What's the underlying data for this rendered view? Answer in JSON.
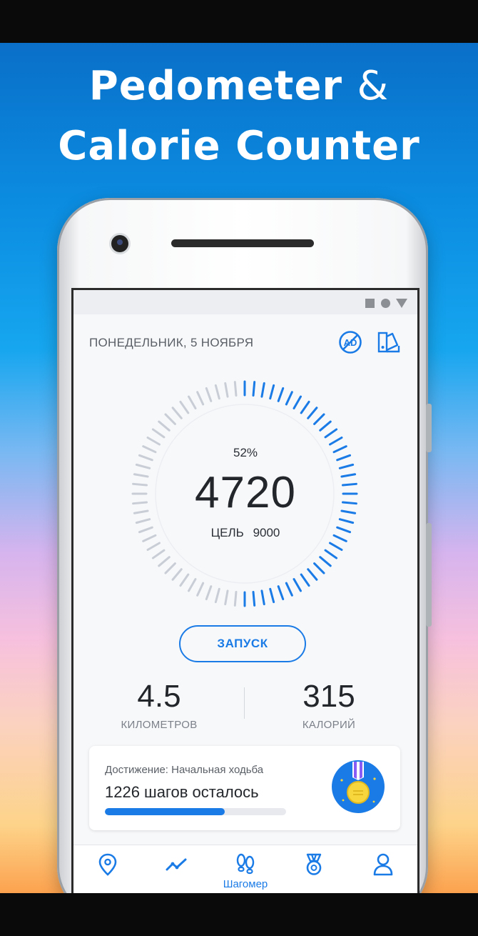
{
  "promo": {
    "line1_word": "Pedometer",
    "line1_amp": "&",
    "line2": "Calorie Counter"
  },
  "header": {
    "date": "ПОНЕДЕЛЬНИК, 5 НОЯБРЯ",
    "icons": [
      "no-ads-icon",
      "theme-palette-icon"
    ]
  },
  "progress": {
    "percent_label": "52%",
    "fraction": 0.52,
    "steps": "4720",
    "goal_label": "ЦЕЛЬ",
    "goal_value": "9000"
  },
  "start_button": "ЗАПУСК",
  "stats": {
    "distance_value": "4.5",
    "distance_label": "КИЛОМЕТРОВ",
    "calories_value": "315",
    "calories_label": "КАЛОРИЙ"
  },
  "achievement": {
    "title": "Достижение: Начальная ходьба",
    "remaining": "1226 шагов осталось",
    "progress_fraction": 0.66,
    "icon": "medal-icon"
  },
  "nav": {
    "items": [
      {
        "icon": "location-pin-icon",
        "label": ""
      },
      {
        "icon": "trend-chart-icon",
        "label": ""
      },
      {
        "icon": "footsteps-icon",
        "label": "Шагомер"
      },
      {
        "icon": "achievement-medal-icon",
        "label": ""
      },
      {
        "icon": "profile-icon",
        "label": ""
      }
    ]
  },
  "colors": {
    "accent": "#1a7be6",
    "ring_inactive": "#c9ced6",
    "text_dark": "#23262b"
  }
}
